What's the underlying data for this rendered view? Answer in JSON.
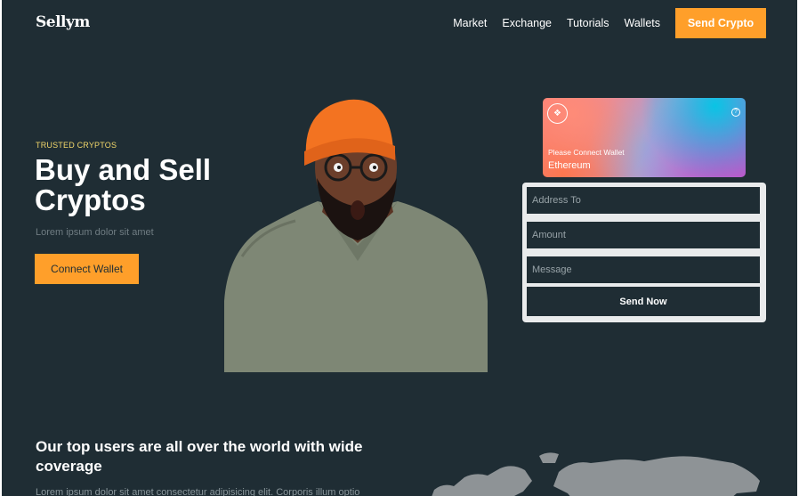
{
  "brand": {
    "logo": "Sellym"
  },
  "nav": {
    "items": [
      "Market",
      "Exchange",
      "Tutorials",
      "Wallets"
    ],
    "cta": "Send Crypto"
  },
  "hero": {
    "eyebrow": "TRUSTED CRYPTOS",
    "title": "Buy and Sell Cryptos",
    "subtitle": "Lorem ipsum dolor sit amet",
    "cta": "Connect Wallet"
  },
  "wallet_card": {
    "status": "Please Connect Wallet",
    "network": "Ethereum"
  },
  "form": {
    "address_placeholder": "Address To",
    "amount_placeholder": "Amount",
    "message_placeholder": "Message",
    "submit": "Send Now"
  },
  "coverage": {
    "title": "Our top users are all over the world with wide coverage",
    "body": "Lorem ipsum dolor sit amet consectetur adipisicing elit. Corporis illum optio"
  },
  "colors": {
    "background": "#1f2d34",
    "accent": "#ff9f2a",
    "eyebrow": "#f1d66a"
  }
}
